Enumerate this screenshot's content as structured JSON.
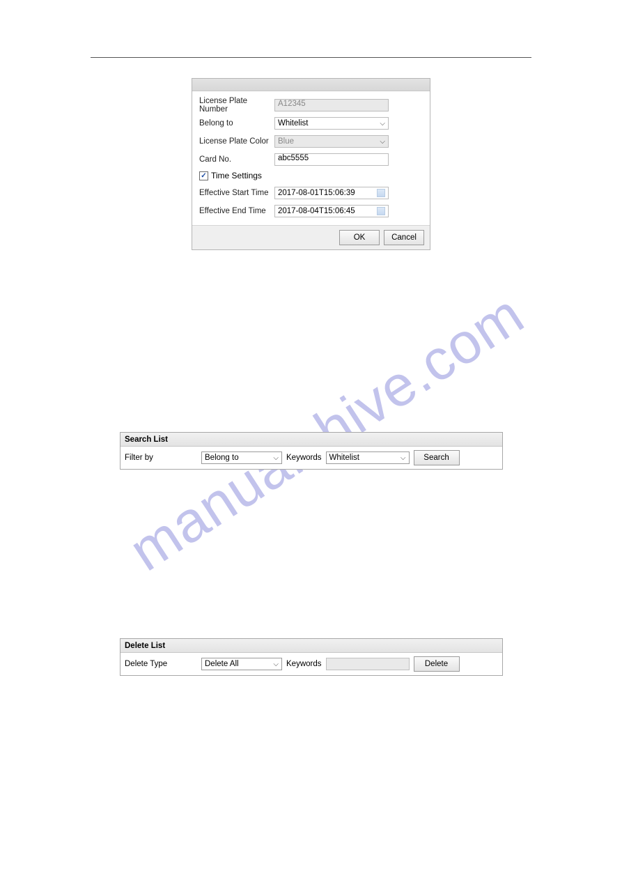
{
  "watermark": "manualshive.com",
  "dialog": {
    "fields": {
      "plate_label": "License Plate Number",
      "plate_value": "A12345",
      "belong_label": "Belong to",
      "belong_value": "Whitelist",
      "color_label": "License Plate Color",
      "color_value": "Blue",
      "card_label": "Card No.",
      "card_value": "abc5555",
      "time_settings_label": "Time Settings",
      "start_label": "Effective Start Time",
      "start_value": "2017-08-01T15:06:39",
      "end_label": "Effective End Time",
      "end_value": "2017-08-04T15:06:45"
    },
    "buttons": {
      "ok": "OK",
      "cancel": "Cancel"
    }
  },
  "search_panel": {
    "title": "Search List",
    "filter_label": "Filter by",
    "filter_value": "Belong to",
    "keywords_label": "Keywords",
    "keywords_value": "Whitelist",
    "button": "Search"
  },
  "delete_panel": {
    "title": "Delete List",
    "type_label": "Delete Type",
    "type_value": "Delete All",
    "keywords_label": "Keywords",
    "button": "Delete"
  }
}
